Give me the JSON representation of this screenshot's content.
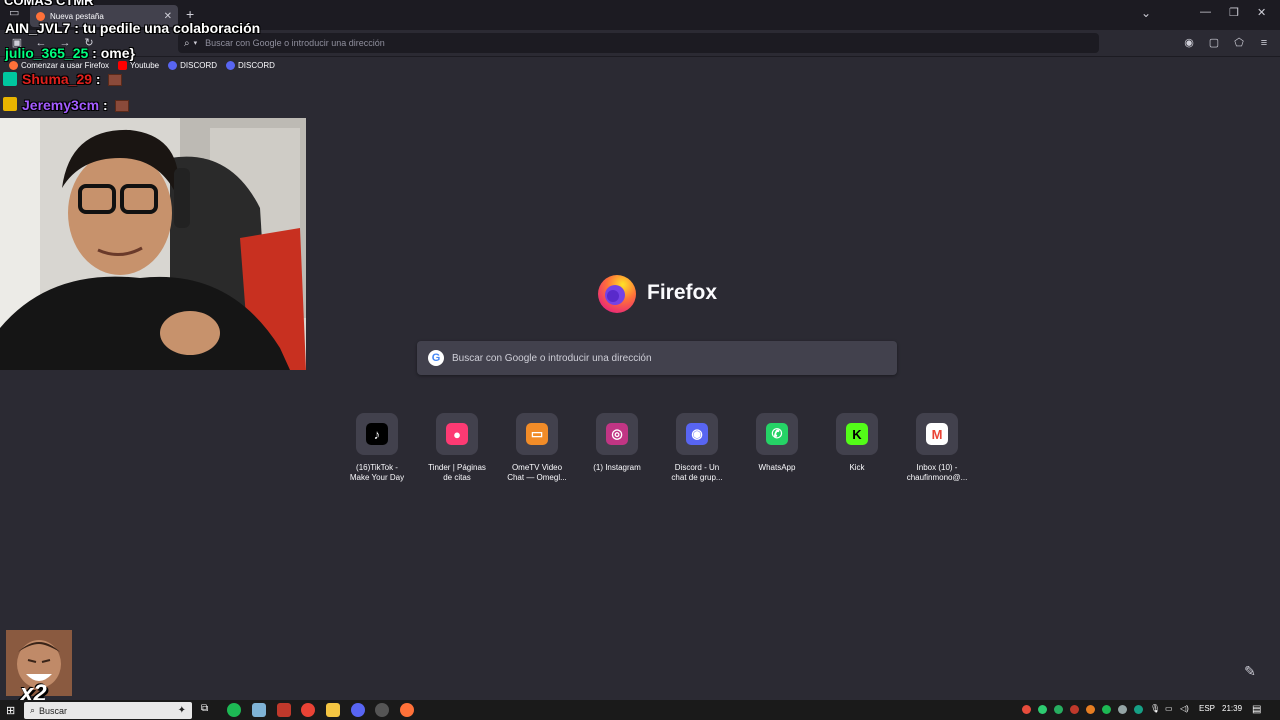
{
  "overlay": {
    "title": "COMAS CTMR",
    "chat": [
      {
        "user": "AIN_JVL7",
        "sep": " : ",
        "text": "tu pedile una colaboración",
        "color": "#ffffff"
      },
      {
        "user": "julio_365_25",
        "sep": " : ",
        "text": "ome}",
        "color": "#00ff7f"
      },
      {
        "user": "Shuma_29",
        "sep": " : ",
        "text": "",
        "color": "#e0201d"
      },
      {
        "user": "Jeremy3cm",
        "sep": " : ",
        "text": "",
        "color": "#a35cff"
      }
    ],
    "multiplier": "x2"
  },
  "browser": {
    "tab_title": "Nueva pestaña",
    "url_placeholder": "Buscar con Google o introducir una dirección",
    "bookmarks": [
      {
        "label": "Comenzar a usar Firefox",
        "color": "#ff7139"
      },
      {
        "label": "Youtube",
        "color": "#ff0000"
      },
      {
        "label": "DISCORD",
        "color": "#5865f2"
      },
      {
        "label": "DISCORD",
        "color": "#5865f2"
      }
    ]
  },
  "home": {
    "brand": "Firefox",
    "search_placeholder": "Buscar con Google o introducir una dirección",
    "google_letter": "G",
    "shortcuts": [
      {
        "label": "(16)TikTok -\nMake Your Day",
        "icon": "tiktok-icon",
        "bg": "#000000",
        "glyph": "♪"
      },
      {
        "label": "Tinder | Páginas\nde citas",
        "icon": "tinder-icon",
        "bg": "#fd3a73",
        "glyph": "●"
      },
      {
        "label": "OmeTV Video\nChat — Omegl...",
        "icon": "ometv-icon",
        "bg": "#f28c28",
        "glyph": "▭"
      },
      {
        "label": "(1) Instagram",
        "icon": "instagram-icon",
        "bg": "#c13584",
        "glyph": "◎"
      },
      {
        "label": "Discord - Un\nchat de grup...",
        "icon": "discord-icon",
        "bg": "#5865f2",
        "glyph": "◉"
      },
      {
        "label": "WhatsApp",
        "icon": "whatsapp-icon",
        "bg": "#25d366",
        "glyph": "✆"
      },
      {
        "label": "Kick",
        "icon": "kick-icon",
        "bg": "#53fc18",
        "glyph": "K"
      },
      {
        "label": "Inbox (10) -\nchaufinmono@...",
        "icon": "gmail-icon",
        "bg": "#ffffff",
        "glyph": "M"
      }
    ]
  },
  "taskbar": {
    "search_label": "Buscar",
    "language": "ESP",
    "time": "21:39"
  }
}
